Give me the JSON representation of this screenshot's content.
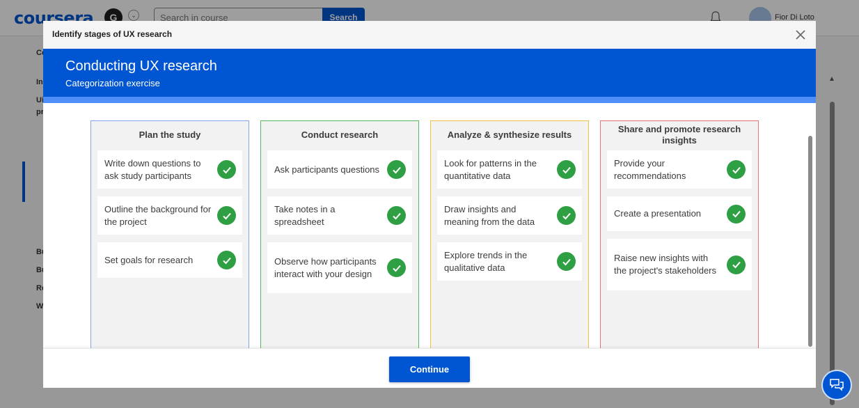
{
  "background": {
    "logo": "coursera",
    "account_initial": "G",
    "search_placeholder": "Search in course",
    "search_button": "Search",
    "user_name": "Fior Di Loto",
    "sidebar_fragments": [
      "Co",
      "In",
      "Ui",
      "pr",
      "Bu",
      "Bu",
      "Re",
      "W"
    ]
  },
  "modal": {
    "title": "Identify stages of UX research",
    "banner_title": "Conducting UX research",
    "banner_subtitle": "Categorization exercise",
    "columns": [
      {
        "header": "Plan the study",
        "border_color": "#7ea7e8",
        "items": [
          "Write down questions to ask study participants",
          "Outline the background for the project",
          "Set goals for research"
        ]
      },
      {
        "header": "Conduct research",
        "border_color": "#5cb85c",
        "items": [
          "Ask participants questions",
          "Take notes in a spreadsheet",
          "Observe how participants interact with your design"
        ]
      },
      {
        "header": "Analyze & synthesize results",
        "border_color": "#f0c040",
        "items": [
          "Look for patterns in the quantitative data",
          "Draw insights and meaning from the data",
          "Explore trends in the qualitative data"
        ]
      },
      {
        "header": "Share and promote research insights",
        "border_color": "#e57373",
        "items": [
          "Provide your recommendations",
          "Create a presentation",
          "Raise new insights with the project's stakeholders"
        ]
      }
    ],
    "continue_label": "Continue"
  },
  "colors": {
    "brand_blue": "#0056d2",
    "check_green": "#2ea043"
  }
}
